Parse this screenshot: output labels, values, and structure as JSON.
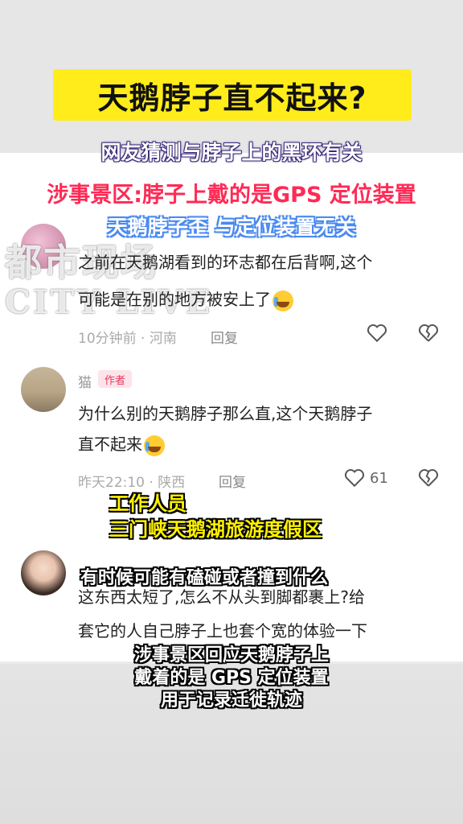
{
  "header": {
    "title": "天鹅脖子直不起来?",
    "line1": "网友猜测与脖子上的黑环有关",
    "line2": "涉事景区:脖子上戴的是GPS 定位装置",
    "line3": "天鹅脖子歪 与定位装置无关"
  },
  "watermark": {
    "line1": "都市现场",
    "line2": "CITY LIVE"
  },
  "comments": [
    {
      "username": "",
      "text_line1": "之前在天鹅湖看到的环志都在后背啊,这个",
      "text_line2": "可能是在别的地方被安上了",
      "meta": "10分钟前 · 河南",
      "reply": "回复",
      "likes": ""
    },
    {
      "username": "猫",
      "badge": "作者",
      "text_line1": "为什么别的天鹅脖子那么直,这个天鹅脖子",
      "text_line2": "直不起来",
      "meta": "昨天22:10 · 陕西",
      "reply": "回复",
      "likes": "61"
    },
    {
      "username": "",
      "text_line1": "这东西太短了,怎么不从头到脚都裹上?给",
      "text_line2": "套它的人自己脖子上也套个宽的体验一下"
    }
  ],
  "captions": {
    "staff_line1": "工作人员",
    "staff_line2": "三门峡天鹅湖旅游度假区",
    "subtitle1": "有时候可能有磕碰或者撞到什么",
    "subtitle2_line1": "涉事景区回应天鹅脖子上",
    "subtitle2_line2": "戴着的是 GPS 定位装置",
    "subtitle2_line3": "用于记录迁徙轨迹"
  },
  "icons": [
    "heart-icon",
    "broken-heart-icon",
    "crying-emoji-icon"
  ],
  "colors": {
    "title_bg": "#ffec1a",
    "red_headline": "#ff2a55",
    "author_badge": "#e8375f"
  }
}
